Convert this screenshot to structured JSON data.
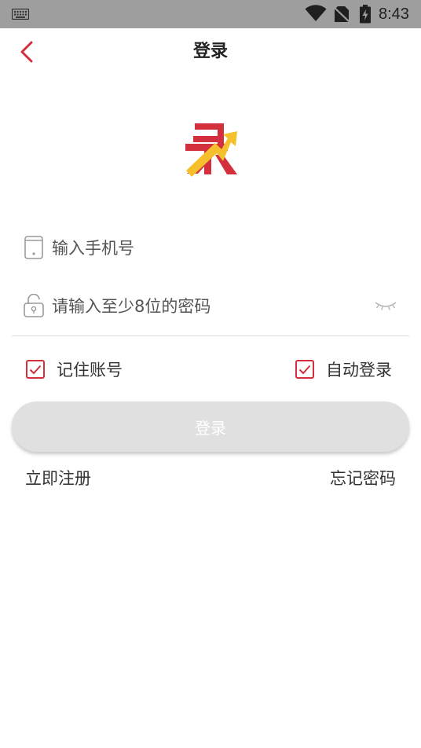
{
  "status_bar": {
    "time": "8:43",
    "icons": [
      "keyboard-icon",
      "wifi-icon",
      "no-sim-icon",
      "battery-charging-icon"
    ]
  },
  "header": {
    "title": "登录",
    "back_icon": "chevron-left-icon"
  },
  "logo": {
    "icon": "app-logo-icon",
    "colors": {
      "red": "#d32f3c",
      "yellow": "#f5c02c"
    }
  },
  "form": {
    "phone": {
      "placeholder": "输入手机号",
      "value": "",
      "icon": "phone-icon"
    },
    "password": {
      "placeholder": "请输入至少8位的密码",
      "value": "",
      "icon": "lock-icon",
      "toggle_icon": "eye-closed-icon"
    },
    "remember_account": {
      "label": "记住账号",
      "checked": true
    },
    "auto_login": {
      "label": "自动登录",
      "checked": true
    },
    "submit_label": "登录"
  },
  "links": {
    "register": "立即注册",
    "forgot_password": "忘记密码"
  },
  "colors": {
    "accent": "#d32f3c",
    "button_disabled": "#e0e0e0",
    "status_bar": "#9e9e9e",
    "text": "#333333"
  }
}
